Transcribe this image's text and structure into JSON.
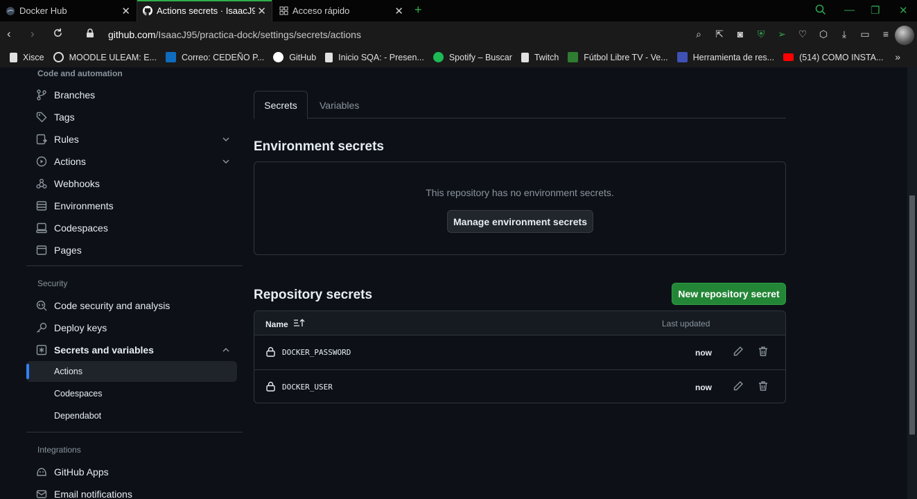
{
  "browser": {
    "tabs": [
      {
        "title": "Docker Hub",
        "active": false
      },
      {
        "title": "Actions secrets · IsaacJ95/p",
        "active": true
      },
      {
        "title": "Acceso rápido",
        "active": false
      }
    ],
    "url_host": "github.com",
    "url_path": "/IsaacJ95/practica-dock/settings/secrets/actions",
    "bookmarks": [
      {
        "label": "Xisce",
        "color": "#e0e0e0"
      },
      {
        "label": "MOODLE ULEAM: E...",
        "color": "#e0e0e0"
      },
      {
        "label": "Correo: CEDEÑO P...",
        "color": "#0f6cbd"
      },
      {
        "label": "GitHub",
        "color": "#ffffff"
      },
      {
        "label": "Inicio SQA: - Presen...",
        "color": "#e0e0e0"
      },
      {
        "label": "Spotify – Buscar",
        "color": "#1db954"
      },
      {
        "label": "Twitch",
        "color": "#e0e0e0"
      },
      {
        "label": "Fútbol Libre TV - Ve...",
        "color": "#2e7d32"
      },
      {
        "label": "Herramienta de res...",
        "color": "#3f51b5"
      },
      {
        "label": "(514) COMO INSTA...",
        "color": "#ff0000"
      }
    ]
  },
  "sidebar": {
    "code_automation_heading": "Code and automation",
    "items_a": [
      {
        "label": "Branches",
        "icon": "branch-icon"
      },
      {
        "label": "Tags",
        "icon": "tag-icon"
      },
      {
        "label": "Rules",
        "icon": "rules-icon",
        "chevron": "down"
      },
      {
        "label": "Actions",
        "icon": "play-icon",
        "chevron": "down"
      },
      {
        "label": "Webhooks",
        "icon": "webhook-icon"
      },
      {
        "label": "Environments",
        "icon": "server-icon"
      },
      {
        "label": "Codespaces",
        "icon": "codespaces-icon"
      },
      {
        "label": "Pages",
        "icon": "browser-icon"
      }
    ],
    "security_heading": "Security",
    "items_b": [
      {
        "label": "Code security and analysis",
        "icon": "codescan-icon"
      },
      {
        "label": "Deploy keys",
        "icon": "key-icon"
      },
      {
        "label": "Secrets and variables",
        "icon": "asterisk-icon",
        "chevron": "up"
      }
    ],
    "sub_items": [
      {
        "label": "Actions",
        "active": true
      },
      {
        "label": "Codespaces",
        "active": false
      },
      {
        "label": "Dependabot",
        "active": false
      }
    ],
    "integrations_heading": "Integrations",
    "items_c": [
      {
        "label": "GitHub Apps",
        "icon": "apps-icon"
      },
      {
        "label": "Email notifications",
        "icon": "mail-icon"
      }
    ]
  },
  "main": {
    "tabs": [
      "Secrets",
      "Variables"
    ],
    "environment_heading": "Environment secrets",
    "environment_empty": "This repository has no environment secrets.",
    "manage_button": "Manage environment secrets",
    "repository_heading": "Repository secrets",
    "new_button": "New repository secret",
    "table": {
      "col_name": "Name",
      "col_updated": "Last updated",
      "rows": [
        {
          "name": "DOCKER_PASSWORD",
          "updated": "now"
        },
        {
          "name": "DOCKER_USER",
          "updated": "now"
        }
      ]
    }
  }
}
